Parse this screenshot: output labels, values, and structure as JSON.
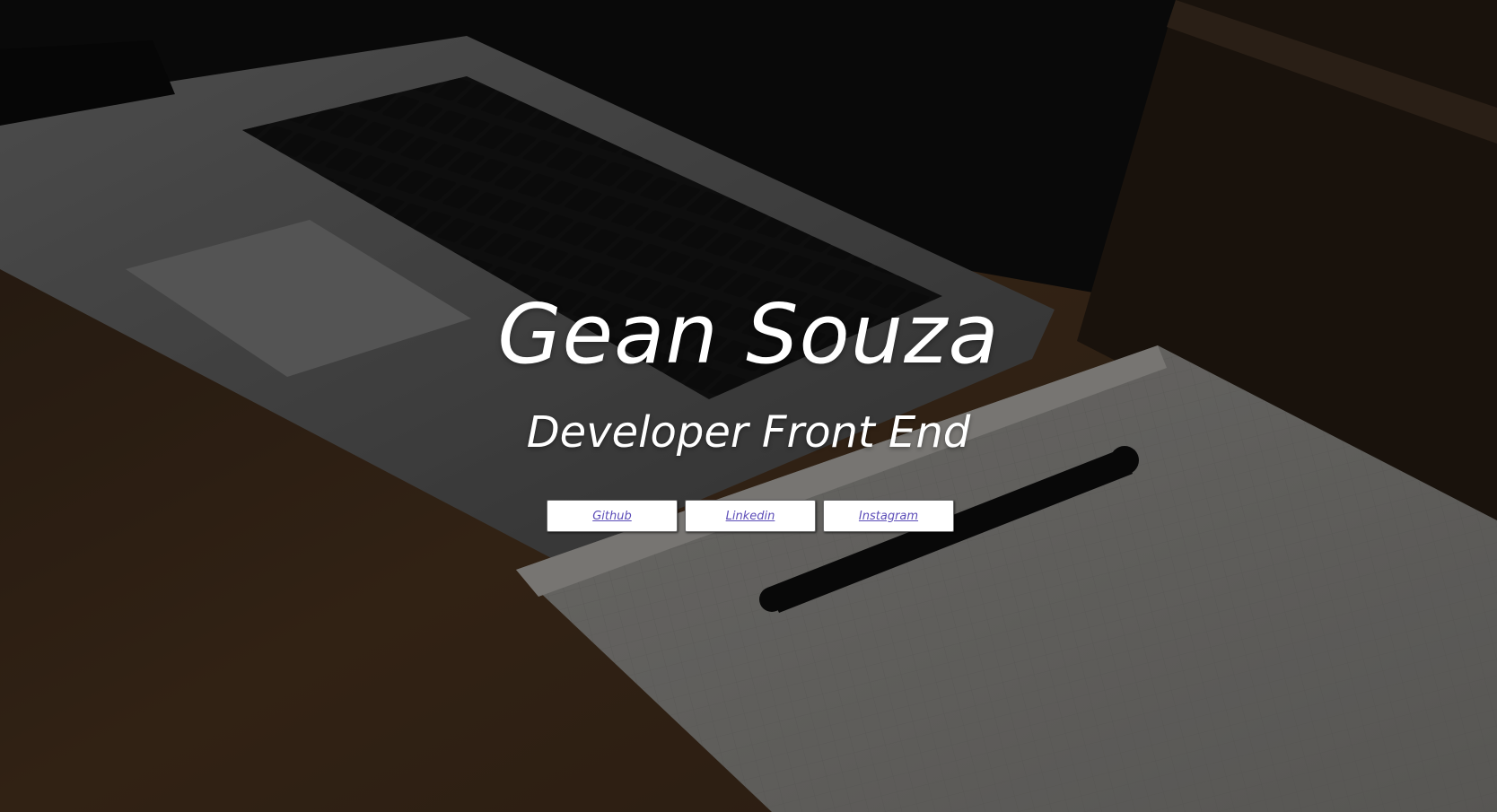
{
  "hero": {
    "title": "Gean Souza",
    "subtitle": "Developer Front End"
  },
  "links": [
    {
      "label": "Github"
    },
    {
      "label": "Linkedin"
    },
    {
      "label": "Instagram"
    }
  ],
  "colors": {
    "overlay": "#000000",
    "title_text": "#ffffff",
    "button_bg": "#ffffff",
    "link_text": "#5c4db8"
  },
  "icons": {
    "background": "laptop-notebook-pen-photo"
  }
}
